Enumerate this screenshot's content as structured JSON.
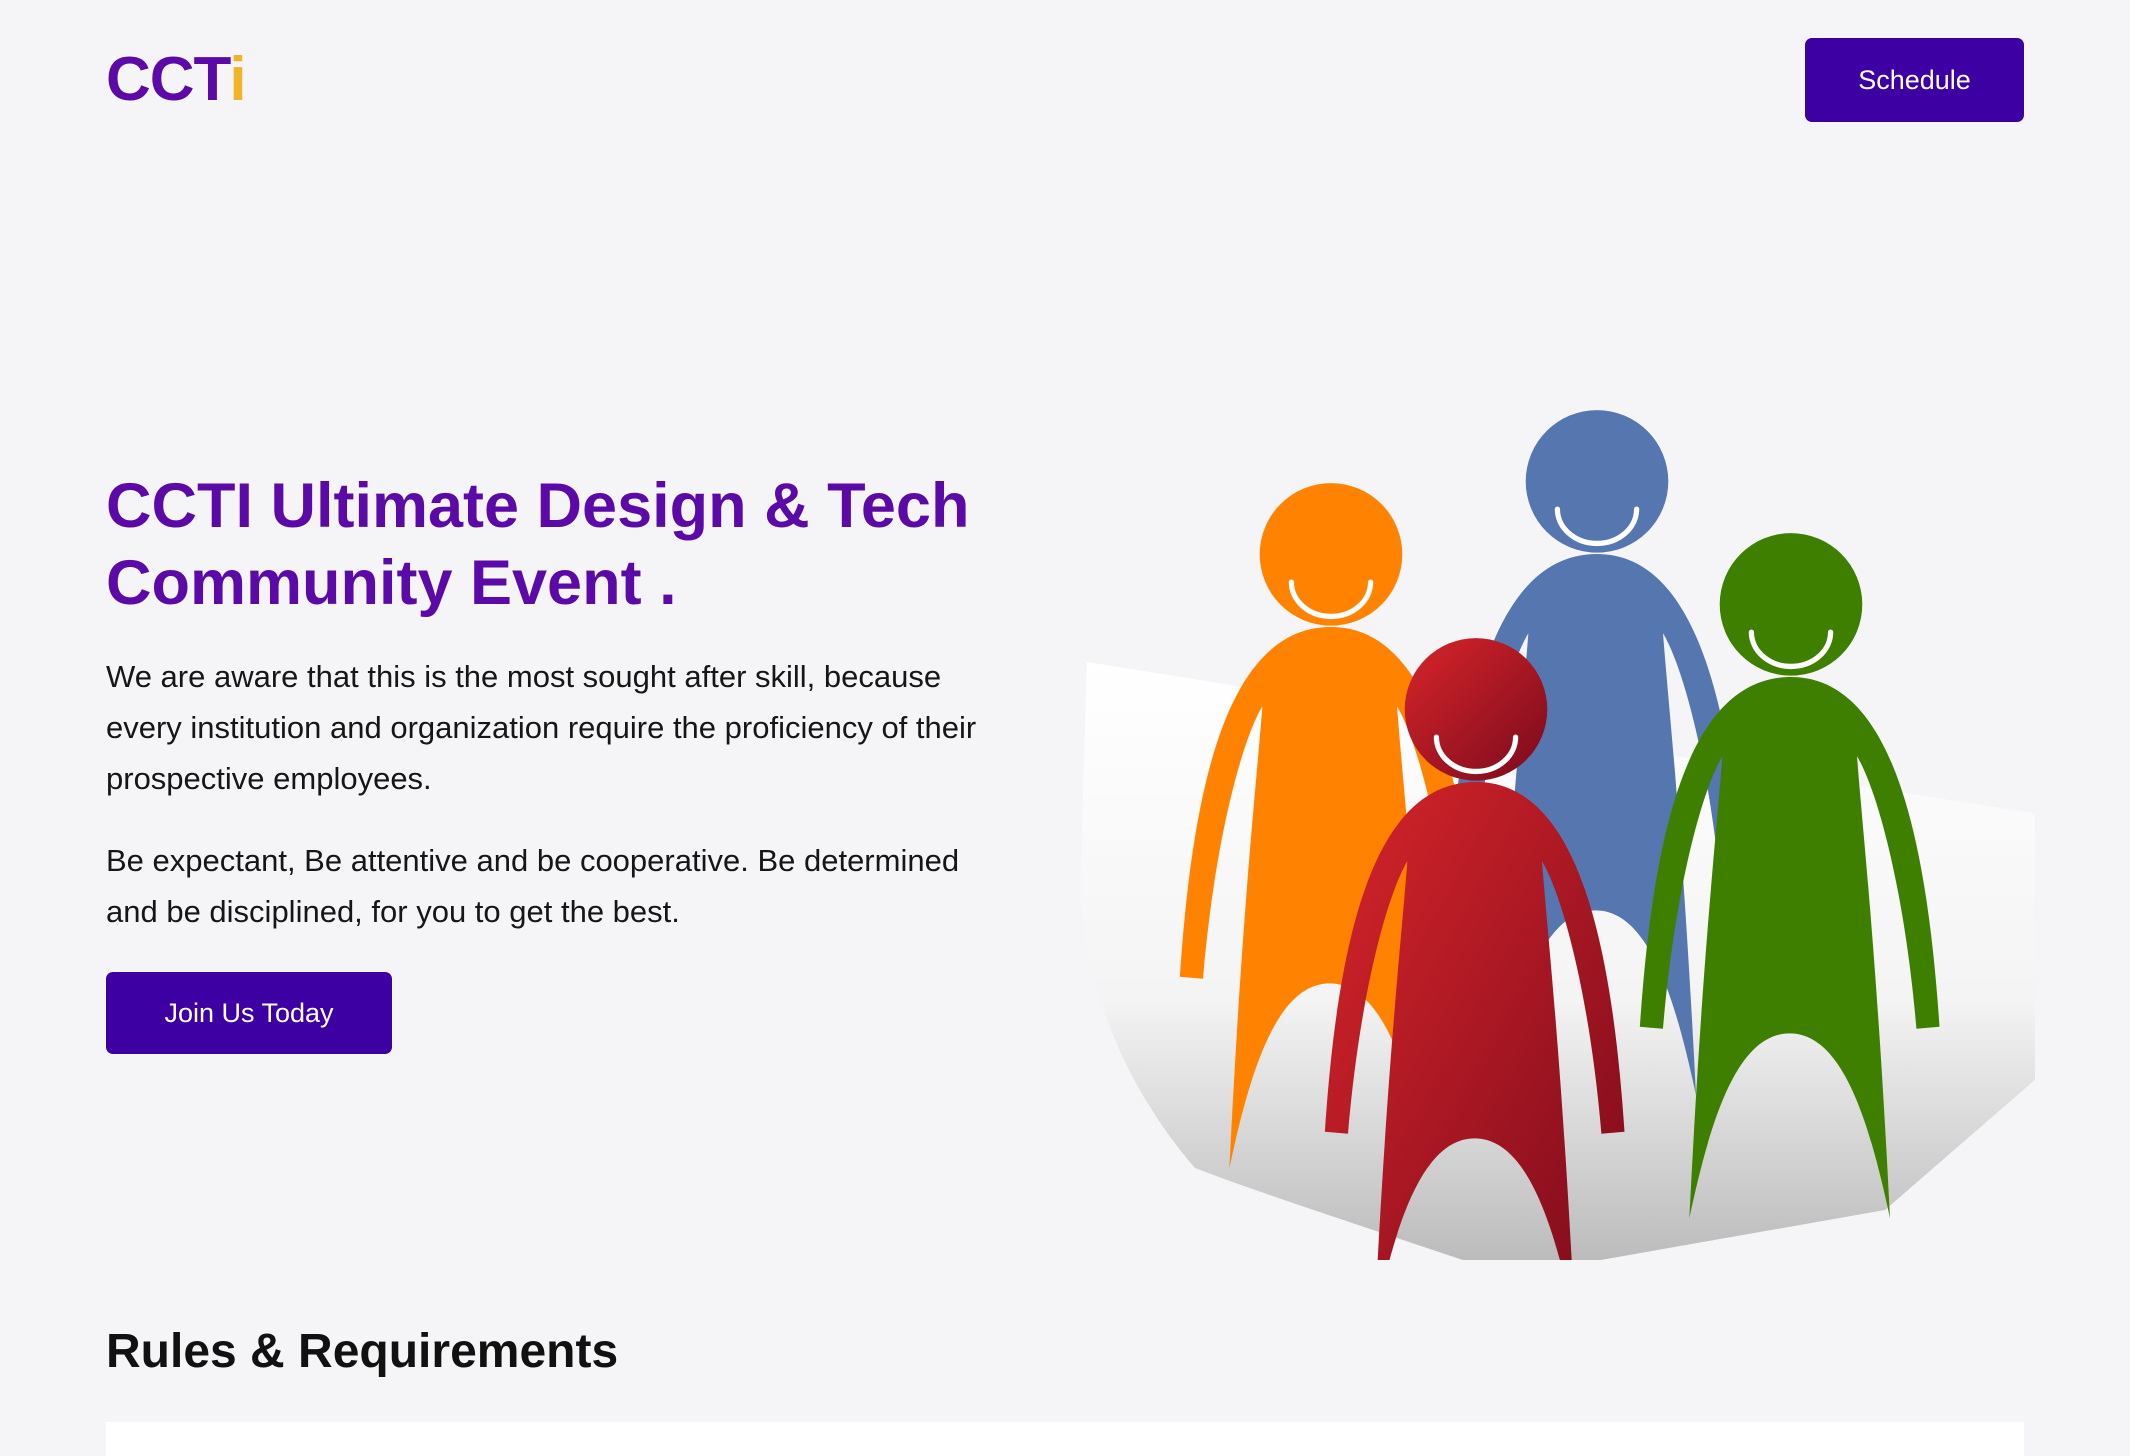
{
  "header": {
    "logo_main": "CCT",
    "logo_accent": "i",
    "schedule_label": "Schedule"
  },
  "hero": {
    "title": "CCTI Ultimate Design & Tech Community Event .",
    "paragraph_1": "We are aware that this is the most sought after skill, because every institution and organization require the proficiency of their prospective employees.",
    "paragraph_2": "Be expectant, Be attentive and be cooperative. Be determined and be disciplined, for you to get the best.",
    "join_label": "Join Us Today"
  },
  "illustration": {
    "figures": [
      {
        "icon": "orange-person-icon",
        "color": "#ff8300"
      },
      {
        "icon": "blue-person-icon",
        "color": "#5676b0"
      },
      {
        "icon": "green-person-icon",
        "color": "#3f7f00"
      },
      {
        "icon": "red-person-icon",
        "color": "#b5171f"
      }
    ]
  },
  "rules": {
    "title": "Rules & Requirements"
  },
  "colors": {
    "background": "#f5f5f7",
    "primary": "#3d00a3",
    "heading": "#5b0aa8",
    "logo_accent": "#f0b429"
  }
}
